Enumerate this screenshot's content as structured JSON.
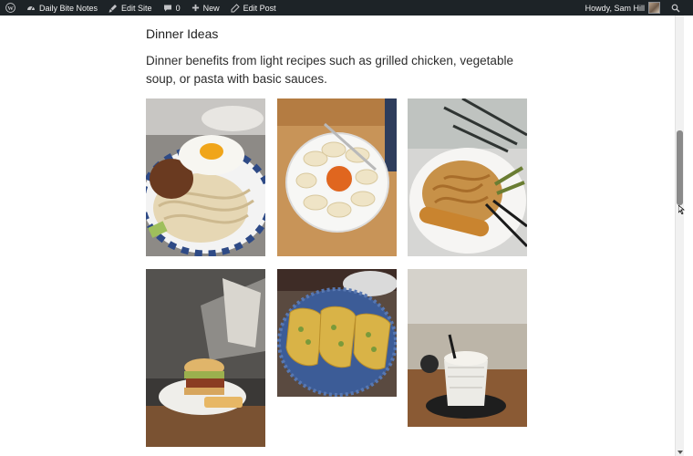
{
  "admin_bar": {
    "wp_logo_icon": "wordpress-logo-icon",
    "site_name": "Daily Bite Notes",
    "edit_site": "Edit Site",
    "comments_count": "0",
    "new_label": "New",
    "edit_post": "Edit Post",
    "howdy": "Howdy, Sam Hill"
  },
  "post": {
    "heading": "Dinner Ideas",
    "paragraph": "Dinner benefits from light recipes such as grilled chicken, vegetable soup, or pasta with basic sauces."
  },
  "gallery": [
    {
      "subject": "noodles with fried egg"
    },
    {
      "subject": "dumplings with dipping sauce"
    },
    {
      "subject": "fried noodles with sausage"
    },
    {
      "subject": "burger on plate"
    },
    {
      "subject": "tacos on blue plate"
    },
    {
      "subject": "iced drink"
    }
  ],
  "colors": {
    "admin_bar_bg": "#1d2327",
    "admin_bar_text": "#f0f0f1",
    "page_bg": "#ffffff",
    "heading_text": "#1e1e1e"
  }
}
